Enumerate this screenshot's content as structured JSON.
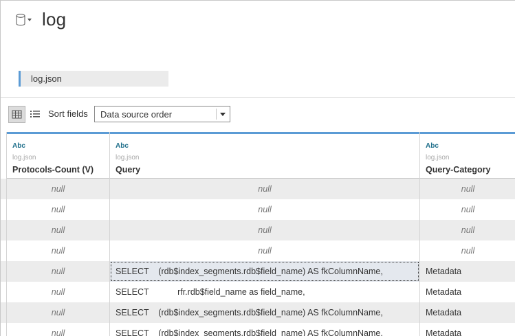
{
  "datasource": {
    "title": "log",
    "connection": "log.json"
  },
  "toolbar": {
    "sort_label": "Sort fields",
    "sort_value": "Data source order"
  },
  "columns": [
    {
      "type": "Abc",
      "source": "log.json",
      "name": "Protocols-Count (V)"
    },
    {
      "type": "Abc",
      "source": "log.json",
      "name": "Query"
    },
    {
      "type": "Abc",
      "source": "log.json",
      "name": "Query-Category"
    }
  ],
  "rows": [
    [
      "null",
      "null",
      "null"
    ],
    [
      "null",
      "null",
      "null"
    ],
    [
      "null",
      "null",
      "null"
    ],
    [
      "null",
      "null",
      "null"
    ],
    [
      "null",
      "SELECT    (rdb$index_segments.rdb$field_name) AS fkColumnName,",
      "Metadata"
    ],
    [
      "null",
      "SELECT            rfr.rdb$field_name as field_name,",
      "Metadata"
    ],
    [
      "null",
      "SELECT    (rdb$index_segments.rdb$field_name) AS fkColumnName,",
      "Metadata"
    ],
    [
      "null",
      "SELECT    (rdb$index_segments.rdb$field_name) AS fkColumnName,",
      "Metadata"
    ]
  ],
  "icons": {
    "datasource": "database-icon",
    "grid_view": "grid-view-icon",
    "list_view": "list-view-icon",
    "dropdown": "chevron-down-icon"
  },
  "colors": {
    "accent": "#5b9bd5",
    "type_label": "#1f6f8b",
    "row_alt": "#ececec"
  }
}
